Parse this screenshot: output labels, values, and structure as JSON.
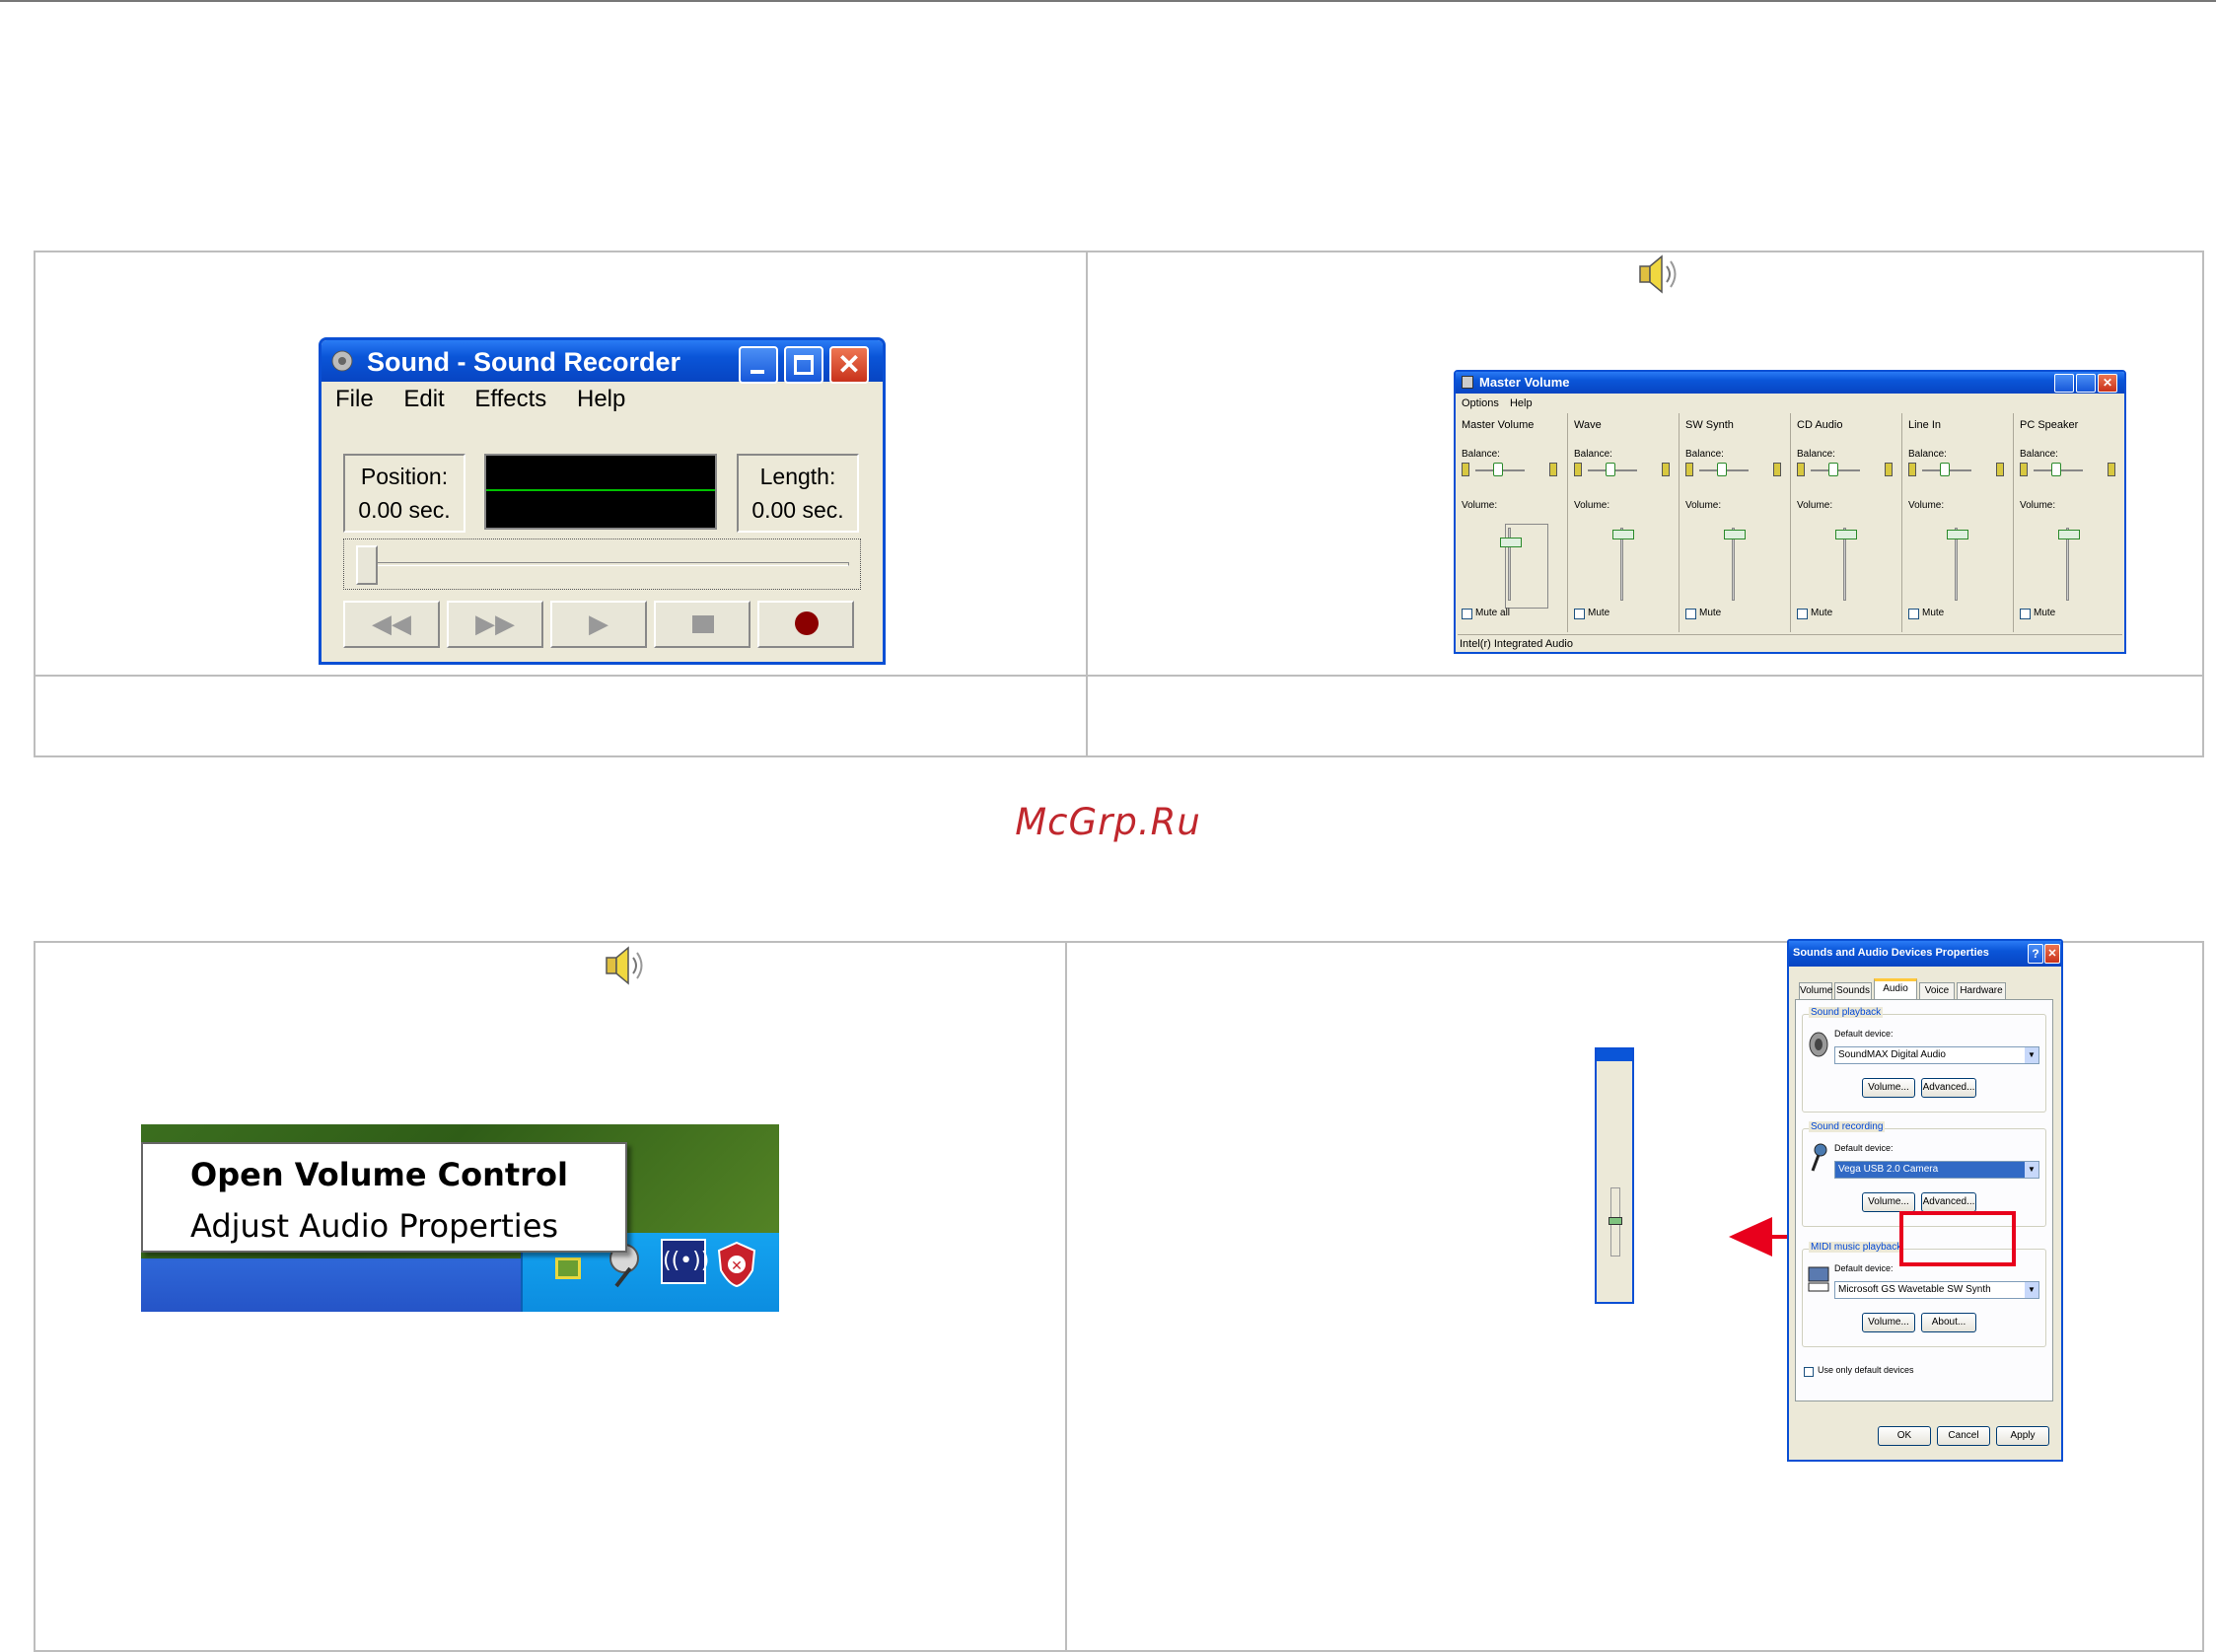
{
  "watermark": "McGrp.Ru",
  "sound_recorder": {
    "title": "Sound - Sound Recorder",
    "menu": [
      "File",
      "Edit",
      "Effects",
      "Help"
    ],
    "position_label": "Position:",
    "position_value": "0.00 sec.",
    "length_label": "Length:",
    "length_value": "0.00 sec.",
    "buttons": [
      "rewind-icon",
      "fast-forward-icon",
      "play-icon",
      "stop-icon",
      "record-icon"
    ]
  },
  "master_volume": {
    "title": "Master Volume",
    "menu": [
      "Options",
      "Help"
    ],
    "channels": [
      {
        "name": "Master Volume",
        "mute": "Mute all"
      },
      {
        "name": "Wave",
        "mute": "Mute"
      },
      {
        "name": "SW Synth",
        "mute": "Mute"
      },
      {
        "name": "CD Audio",
        "mute": "Mute"
      },
      {
        "name": "Line In",
        "mute": "Mute"
      },
      {
        "name": "PC Speaker",
        "mute": "Mute"
      }
    ],
    "balance_label": "Balance:",
    "volume_label": "Volume:",
    "status": "Intel(r) Integrated Audio"
  },
  "tray": {
    "menu": [
      "Open Volume Control",
      "Adjust Audio Properties"
    ]
  },
  "sound_props": {
    "title": "Sounds and Audio Devices Properties",
    "tabs": [
      "Volume",
      "Sounds",
      "Audio",
      "Voice",
      "Hardware"
    ],
    "playback": {
      "group": "Sound playback",
      "label": "Default device:",
      "device": "SoundMAX Digital Audio",
      "btn1": "Volume...",
      "btn2": "Advanced..."
    },
    "recording": {
      "group": "Sound recording",
      "label": "Default device:",
      "device": "Vega USB 2.0 Camera",
      "btn1": "Volume...",
      "btn2": "Advanced..."
    },
    "midi": {
      "group": "MIDI music playback",
      "label": "Default device:",
      "device": "Microsoft GS Wavetable SW Synth",
      "btn1": "Volume...",
      "btn2": "About..."
    },
    "only_default": "Use only default devices",
    "ok": "OK",
    "cancel": "Cancel",
    "apply": "Apply"
  },
  "colors": {
    "xp_blue": "#0a55d8",
    "highlight_red": "#e8001c",
    "watermark": "#c0272d"
  }
}
